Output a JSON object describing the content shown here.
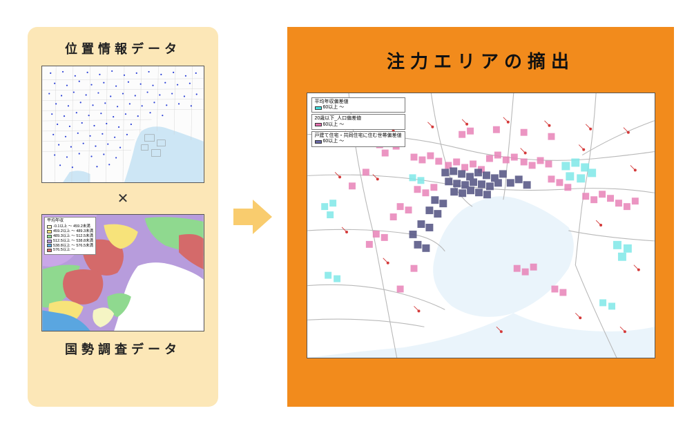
{
  "left": {
    "top_title": "位置情報データ",
    "multiply_symbol": "✕",
    "bottom_title": "国勢調査データ",
    "census_legend_title": "平均年収",
    "census_legend": [
      {
        "label": "-0.1以上 ～ 459.2未満",
        "color": "#f5f5c4"
      },
      {
        "label": "459.2以上 ～ 489.3未満",
        "color": "#f7e37a"
      },
      {
        "label": "489.3以上 ～ 512.5未満",
        "color": "#8fd98f"
      },
      {
        "label": "512.5以上 ～ 538.8未満",
        "color": "#b79cdc"
      },
      {
        "label": "538.8以上 ～ 576.5未満",
        "color": "#5aa6e0"
      },
      {
        "label": "576.5以上 ～",
        "color": "#d46a6a"
      }
    ]
  },
  "right": {
    "title": "注力エリアの摘出",
    "layers": [
      {
        "title": "平均年収偏差値",
        "threshold": "60以上 ～",
        "color": "#46e0e0"
      },
      {
        "title": "20歳以下_人口偏差値",
        "threshold": "60以上 ～",
        "color": "#e56fae"
      },
      {
        "title": "戸建て住宅・共同住宅に住む世帯偏差値",
        "threshold": "60以上 ～",
        "color": "#6a6aa8"
      }
    ]
  }
}
